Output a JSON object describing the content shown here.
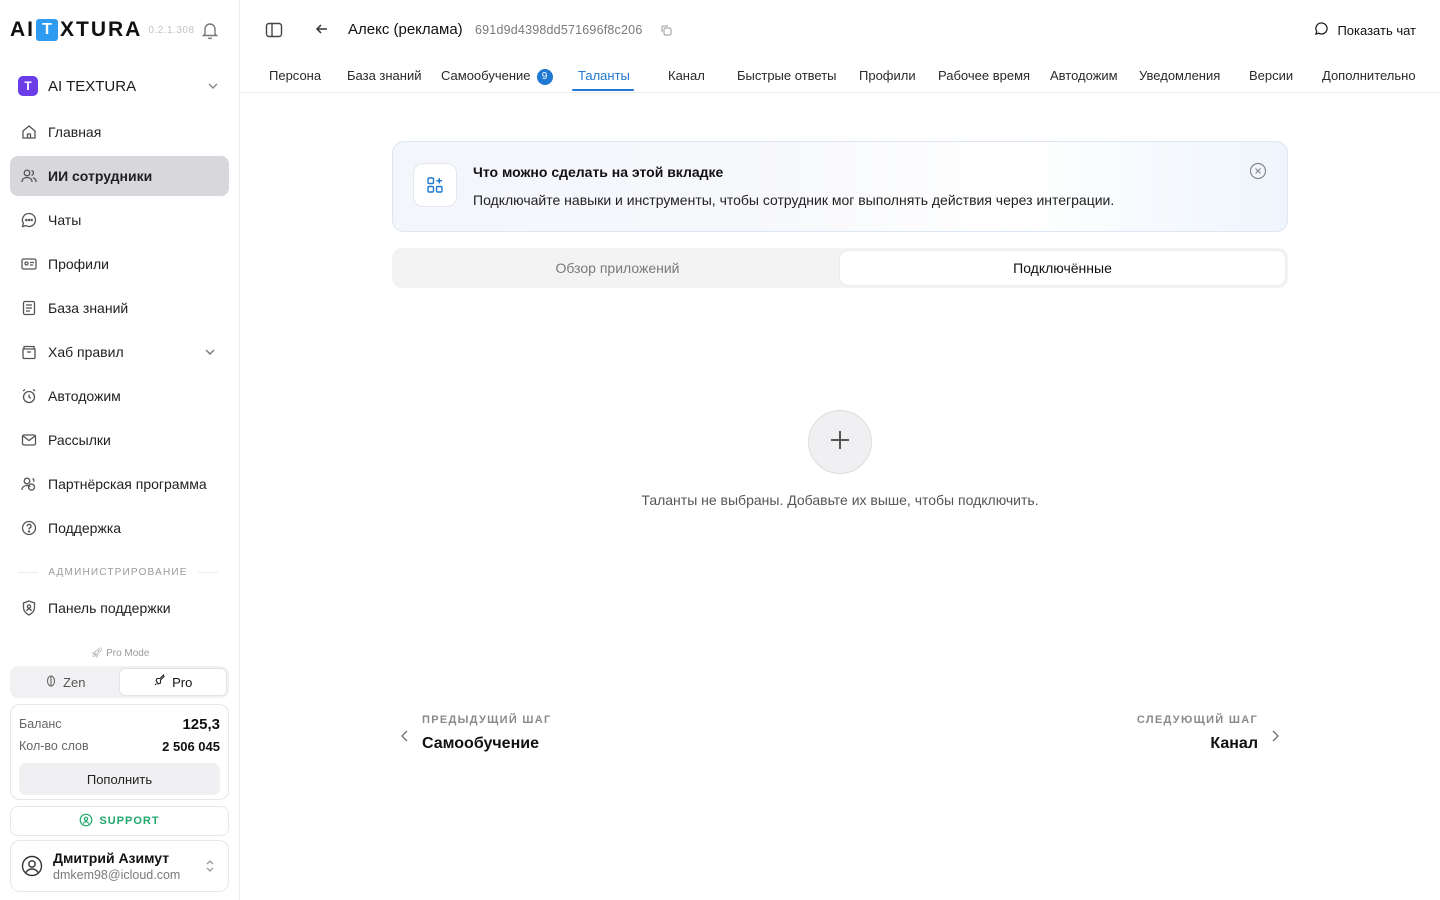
{
  "app": {
    "logo_prefix": "AI",
    "logo_t": "T",
    "logo_suffix": "XTURA",
    "version": "0.2.1.308"
  },
  "workspace": {
    "badge": "T",
    "name": "AI TEXTURA"
  },
  "sidebar": {
    "items": [
      {
        "label": "Главная",
        "icon": "home-icon"
      },
      {
        "label": "ИИ сотрудники",
        "icon": "users-icon",
        "active": true
      },
      {
        "label": "Чаты",
        "icon": "chat-bubble-icon"
      },
      {
        "label": "Профили",
        "icon": "profile-card-icon"
      },
      {
        "label": "База знаний",
        "icon": "document-icon"
      },
      {
        "label": "Хаб правил",
        "icon": "folder-icon",
        "expandable": true
      },
      {
        "label": "Автодожим",
        "icon": "alarm-clock-icon"
      },
      {
        "label": "Рассылки",
        "icon": "mail-icon"
      },
      {
        "label": "Партнёрская программа",
        "icon": "partner-icon"
      },
      {
        "label": "Поддержка",
        "icon": "help-circle-icon"
      }
    ],
    "admin_section": "АДМИНИСТРИРОВАНИЕ",
    "admin_items": [
      {
        "label": "Панель поддержки",
        "icon": "shield-user-icon"
      }
    ],
    "pro_mode_label": "Pro Mode",
    "modes": [
      {
        "label": "Zen",
        "icon": "leaf-icon"
      },
      {
        "label": "Pro",
        "icon": "rocket-icon",
        "active": true
      }
    ],
    "balance": {
      "balance_label": "Баланс",
      "balance_value": "125,3",
      "words_label": "Кол-во слов",
      "words_value": "2 506 045",
      "topup_label": "Пополнить"
    },
    "support_label": "SUPPORT",
    "user": {
      "name": "Дмитрий Азимут",
      "email": "dmkem98@icloud.com"
    }
  },
  "header": {
    "agent_name": "Алекс (реклама)",
    "agent_id": "691d9d4398dd571696f8c206",
    "show_chat_label": "Показать чат"
  },
  "tabs": [
    {
      "label": "Персона"
    },
    {
      "label": "База знаний"
    },
    {
      "label": "Самообучение",
      "badge": "9"
    },
    {
      "label": "Таланты",
      "active": true
    },
    {
      "label": "Канал"
    },
    {
      "label": "Быстрые ответы"
    },
    {
      "label": "Профили"
    },
    {
      "label": "Рабочее время"
    },
    {
      "label": "Автодожим"
    },
    {
      "label": "Уведомления"
    },
    {
      "label": "Версии"
    },
    {
      "label": "Дополнительно"
    }
  ],
  "info": {
    "title": "Что можно сделать на этой вкладке",
    "description": "Подключайте навыки и инструменты, чтобы сотрудник мог выполнять действия через интеграции."
  },
  "segments": [
    {
      "label": "Обзор приложений"
    },
    {
      "label": "Подключённые",
      "active": true
    }
  ],
  "empty_state": {
    "text": "Таланты не выбраны. Добавьте их выше, чтобы подключить."
  },
  "steps": {
    "prev_label": "ПРЕДЫДУЩИЙ ШАГ",
    "prev_value": "Самообучение",
    "next_label": "СЛЕДУЮЩИЙ ШАГ",
    "next_value": "Канал"
  },
  "colors": {
    "accent": "#1f78d1",
    "workspace_badge": "#6b3ee8",
    "logo_box": "#2f9bf0",
    "support": "#20a86b"
  }
}
